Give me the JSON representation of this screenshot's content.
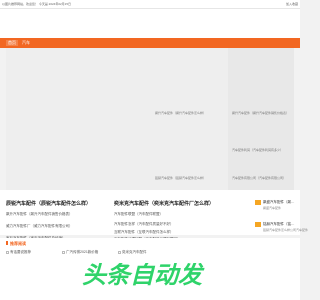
{
  "topbar": {
    "left_text": "以图片推荐网站，欢迎您！ 今天是 2024年02月15日",
    "right_text": "加入收藏"
  },
  "search": {
    "placeholder": "请输入关键词搜索"
  },
  "nav": {
    "items": [
      "首页",
      "汽车"
    ]
  },
  "hero_captions": [
    "飙升汽车配件（飙升汽车配件怎么样）",
    "飙升汽车配件（飙升汽车配件销售价格表）",
    "铭赫汽车配件（铭赫汽车配件怎么样）",
    "汽车配件利润（汽车配件利润有多少）",
    "汽车配件有限公司（汽车配件有限公司）"
  ],
  "columns": [
    {
      "title": "辰锐汽车配件（辰锐汽车配件怎么样）",
      "links": [
        "飙升汽车配件（飙升汽车配件销售价格表）",
        "威力汽车配件厂（威力汽车配件有限公司）",
        "宝石汽车配件（宝石汽车配件总经销）"
      ]
    },
    {
      "title": "奕米克汽车配件（奕米克汽车配件厂怎么样）",
      "links": [
        "汽车配件联盟（汽车配件联盟）",
        "汽车配件怎样（汽车配件质量好不好）",
        "互联汽车配件（互联汽车配件怎么样）",
        "汽车配件代理加盟（汽车配件代理加盟网）"
      ]
    }
  ],
  "side_list": [
    {
      "title": "飙盛汽车配件（飙…",
      "sub": "飙盛汽车配件"
    },
    {
      "title": "铭赫汽车配件（铭…",
      "sub": "铭赫汽车配件怎么样公司汽车配件"
    }
  ],
  "recommend": {
    "title": "推荐阅读",
    "items": [
      "有话要说推荐",
      "广汽传祺2021款价格",
      "奕米克汽车配件"
    ]
  },
  "watermark": {
    "text": "头条自动发",
    "color": "#2fd36a"
  },
  "colors": {
    "accent": "#f26722"
  }
}
